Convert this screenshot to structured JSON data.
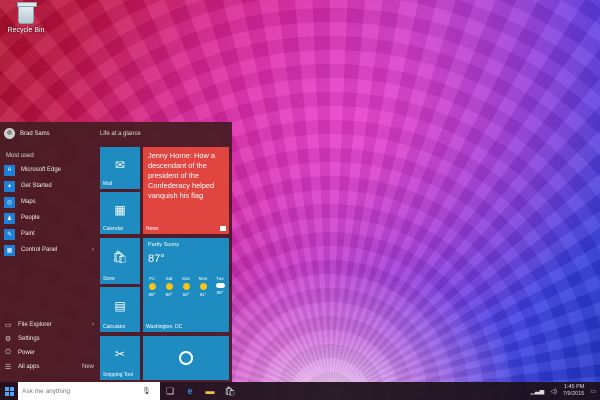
{
  "desktop": {
    "icon_label": "Recycle Bin"
  },
  "start_menu": {
    "user_name": "Brad Sams",
    "most_used_label": "Most used",
    "most_used": [
      {
        "label": "Microsoft Edge",
        "icon": "edge-icon",
        "has_arrow": false
      },
      {
        "label": "Get Started",
        "icon": "get-started-icon",
        "has_arrow": false
      },
      {
        "label": "Maps",
        "icon": "maps-icon",
        "has_arrow": false
      },
      {
        "label": "People",
        "icon": "people-icon",
        "has_arrow": false
      },
      {
        "label": "Paint",
        "icon": "paint-icon",
        "has_arrow": false
      },
      {
        "label": "Control Panel",
        "icon": "control-panel-icon",
        "has_arrow": true
      }
    ],
    "bottom": [
      {
        "label": "File Explorer",
        "icon": "file-explorer-icon",
        "right": "›"
      },
      {
        "label": "Settings",
        "icon": "settings-icon",
        "right": ""
      },
      {
        "label": "Power",
        "icon": "power-icon",
        "right": ""
      },
      {
        "label": "All apps",
        "icon": "all-apps-icon",
        "right": "New"
      }
    ],
    "tiles_heading": "Life at a glance",
    "tiles": {
      "mail": "Mail",
      "calendar": "Calendar",
      "store": "Store",
      "calculator": "Calculator",
      "snipping": "Snipping Tool",
      "news_text": "Jenny Horne: How a descendant of the president of the Confederacy helped vanquish his flag",
      "news_label": "News"
    },
    "weather": {
      "city": "Partly Sunny",
      "temp": "87°",
      "location": "Washington, DC",
      "forecast": [
        {
          "day": "Fri",
          "temp": "88°",
          "kind": "sun"
        },
        {
          "day": "Sat",
          "temp": "90°",
          "kind": "sun"
        },
        {
          "day": "Sun",
          "temp": "93°",
          "kind": "sun"
        },
        {
          "day": "Mon",
          "temp": "91°",
          "kind": "sun"
        },
        {
          "day": "Tue",
          "temp": "89°",
          "kind": "cloud"
        }
      ]
    }
  },
  "taskbar": {
    "search_placeholder": "Ask me anything",
    "time": "1:45 PM",
    "date": "7/9/2015"
  },
  "colors": {
    "tile_blue": "#1e8cc1",
    "tile_red": "#e0463f",
    "start_bg": "#461c22"
  }
}
